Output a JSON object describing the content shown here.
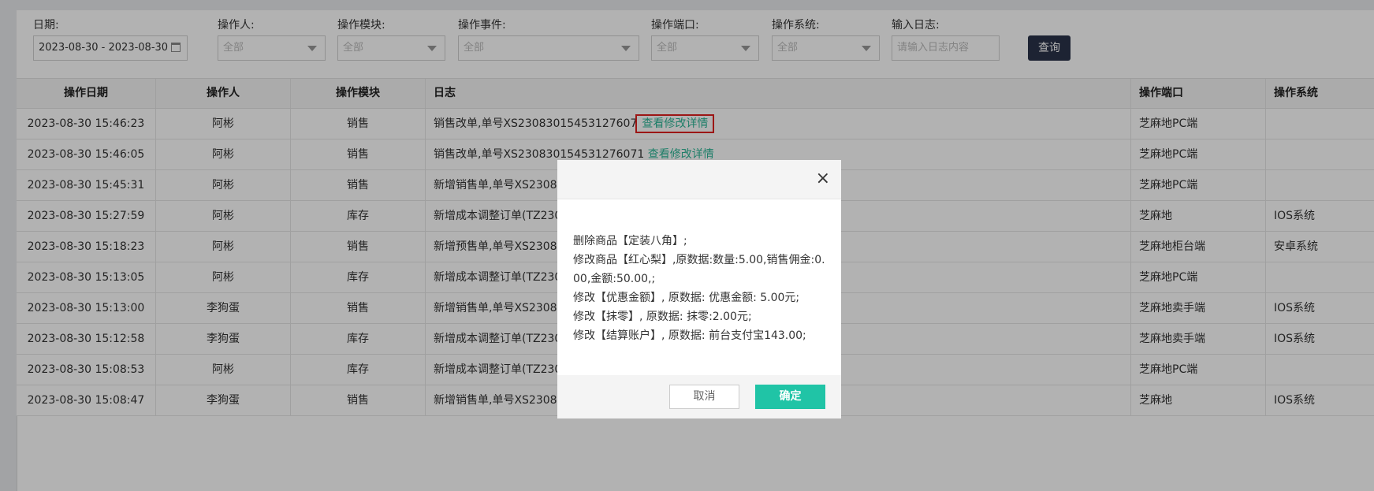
{
  "filters": {
    "date_label": "日期:",
    "date_value": "2023-08-30 - 2023-08-30",
    "operator_label": "操作人:",
    "operator_value": "全部",
    "module_label": "操作模块:",
    "module_value": "全部",
    "event_label": "操作事件:",
    "event_value": "全部",
    "port_label": "操作端口:",
    "port_value": "全部",
    "system_label": "操作系统:",
    "system_value": "全部",
    "log_label": "输入日志:",
    "log_placeholder": "请输入日志内容",
    "query_button": "查询"
  },
  "table": {
    "headers": [
      "操作日期",
      "操作人",
      "操作模块",
      "日志",
      "操作端口",
      "操作系统"
    ],
    "rows": [
      {
        "date": "2023-08-30 15:46:23",
        "operator": "阿彬",
        "module": "销售",
        "log": "销售改单,单号XS23083015453127607",
        "port": "芝麻地PC端",
        "system": ""
      },
      {
        "date": "2023-08-30 15:46:05",
        "operator": "阿彬",
        "module": "销售",
        "log": "销售改单,单号XS230830154531276071",
        "port": "芝麻地PC端",
        "system": ""
      },
      {
        "date": "2023-08-30 15:45:31",
        "operator": "阿彬",
        "module": "销售",
        "log": "新增销售单,单号XS23083",
        "port": "芝麻地PC端",
        "system": ""
      },
      {
        "date": "2023-08-30 15:27:59",
        "operator": "阿彬",
        "module": "库存",
        "log": "新增成本调整订单(TZ230",
        "port": "芝麻地",
        "system": "IOS系统"
      },
      {
        "date": "2023-08-30 15:18:23",
        "operator": "阿彬",
        "module": "销售",
        "log": "新增预售单,单号XS23083",
        "port": "芝麻地柜台端",
        "system": "安卓系统"
      },
      {
        "date": "2023-08-30 15:13:05",
        "operator": "阿彬",
        "module": "库存",
        "log": "新增成本调整订单(TZ230",
        "port": "芝麻地PC端",
        "system": ""
      },
      {
        "date": "2023-08-30 15:13:00",
        "operator": "李狗蛋",
        "module": "销售",
        "log": "新增销售单,单号XS23083",
        "port": "芝麻地卖手端",
        "system": "IOS系统"
      },
      {
        "date": "2023-08-30 15:12:58",
        "operator": "李狗蛋",
        "module": "库存",
        "log": "新增成本调整订单(TZ230",
        "port": "芝麻地卖手端",
        "system": "IOS系统"
      },
      {
        "date": "2023-08-30 15:08:53",
        "operator": "阿彬",
        "module": "库存",
        "log": "新增成本调整订单(TZ230",
        "port": "芝麻地PC端",
        "system": ""
      },
      {
        "date": "2023-08-30 15:08:47",
        "operator": "李狗蛋",
        "module": "销售",
        "log": "新增销售单,单号XS23083",
        "port": "芝麻地",
        "system": "IOS系统"
      }
    ],
    "detail_link": "查看修改详情"
  },
  "modal": {
    "close_icon": "×",
    "lines": [
      "删除商品【定装八角】;",
      "修改商品【红心梨】,原数据:数量:5.00,销售佣金:0.00,金额:50.00,;",
      "修改【优惠金额】, 原数据: 优惠金额: 5.00元;",
      "修改【抹零】, 原数据: 抹零:2.00元;",
      "修改【结算账户】, 原数据: 前台支付宝143.00;"
    ],
    "cancel_button": "取消",
    "ok_button": "确定"
  }
}
